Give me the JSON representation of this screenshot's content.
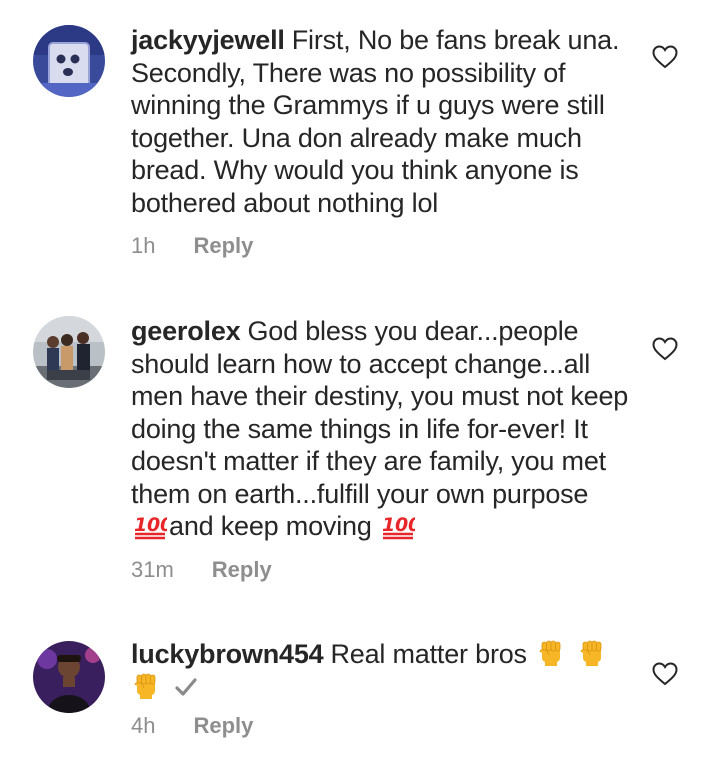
{
  "comments": [
    {
      "username": "jackyyjewell",
      "text": "First, No be fans break una. Secondly, There was no possibility of winning the Grammys if u guys were still together.  Una don already make much bread. Why would you think anyone is bothered about nothing lol",
      "time": "1h",
      "reply_label": "Reply",
      "avatar_icon": "ghost-avatar"
    },
    {
      "username": "geerolex",
      "text_parts": [
        "God bless you dear...people should learn how to accept change...all men have their destiny, you must not keep doing the same things in life for-ever! It doesn't matter if they are family, you met them on earth...fulfill your own purpose ",
        "and keep moving "
      ],
      "emoji": "100-emoji",
      "time": "31m",
      "reply_label": "Reply",
      "avatar_icon": "group-photo-avatar"
    },
    {
      "username": "luckybrown454",
      "text": "Real matter bros",
      "emojis": [
        "raised-fist-emoji",
        "raised-fist-emoji",
        "raised-fist-emoji",
        "check-mark-emoji"
      ],
      "time": "4h",
      "reply_label": "Reply",
      "avatar_icon": "person-photo-avatar"
    }
  ],
  "colors": {
    "text": "#262626",
    "meta": "#8e8e8e",
    "emoji_100": "#e8262a",
    "fist": "#f7b625"
  }
}
